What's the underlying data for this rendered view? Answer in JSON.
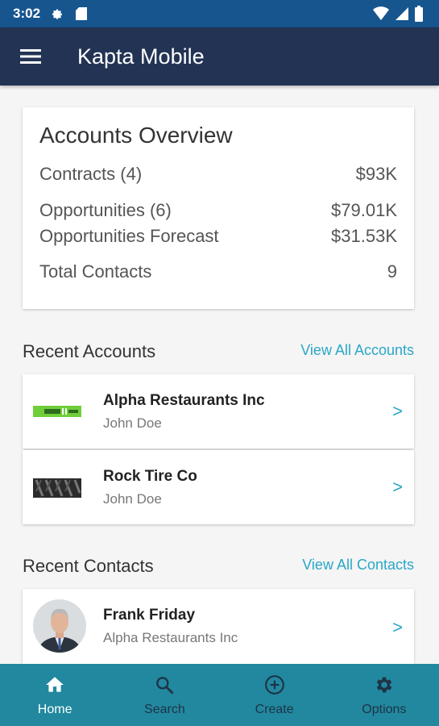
{
  "status_bar": {
    "time": "3:02"
  },
  "app_bar": {
    "title": "Kapta Mobile"
  },
  "overview": {
    "title": "Accounts Overview",
    "rows": [
      {
        "label": "Contracts (4)",
        "value": "$93K"
      },
      {
        "label": "Opportunities (6)",
        "value": "$79.01K"
      },
      {
        "label": "Opportunities Forecast",
        "value": "$31.53K"
      },
      {
        "label": "Total Contacts",
        "value": "9"
      }
    ]
  },
  "recent_accounts": {
    "title": "Recent Accounts",
    "link": "View All Accounts",
    "items": [
      {
        "name": "Alpha Restaurants Inc",
        "owner": "John Doe",
        "chevron": ">"
      },
      {
        "name": "Rock Tire Co",
        "owner": "John Doe",
        "chevron": ">"
      }
    ]
  },
  "recent_contacts": {
    "title": "Recent Contacts",
    "link": "View All Contacts",
    "items": [
      {
        "name": "Frank Friday",
        "company": "Alpha Restaurants Inc",
        "chevron": ">"
      }
    ]
  },
  "bottom_nav": {
    "items": [
      {
        "label": "Home",
        "icon": "home-icon",
        "active": true
      },
      {
        "label": "Search",
        "icon": "search-icon",
        "active": false
      },
      {
        "label": "Create",
        "icon": "add-circle-icon",
        "active": false
      },
      {
        "label": "Options",
        "icon": "gear-icon",
        "active": false
      }
    ]
  },
  "colors": {
    "status_bar": "#17558f",
    "app_bar": "#223354",
    "accent": "#2aa7c7",
    "bottom_nav": "#21889f"
  }
}
